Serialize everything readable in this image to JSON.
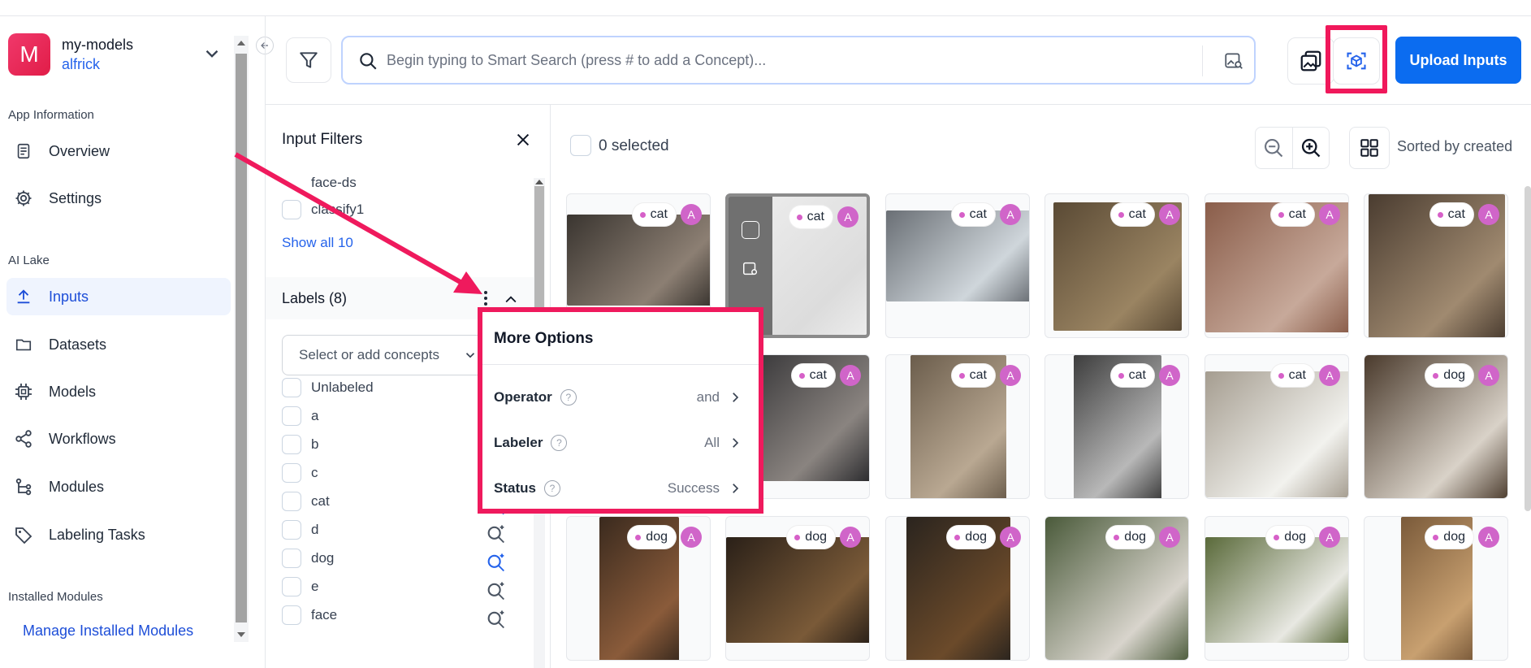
{
  "app": {
    "initial": "M",
    "name": "my-models",
    "user": "alfrick"
  },
  "sidebar": {
    "section_app": "App Information",
    "section_lake": "AI Lake",
    "section_modules": "Installed Modules",
    "items": [
      {
        "label": "Overview",
        "icon": "document-icon"
      },
      {
        "label": "Settings",
        "icon": "gear-icon"
      },
      {
        "label": "Inputs",
        "icon": "upload-icon"
      },
      {
        "label": "Datasets",
        "icon": "folder-icon"
      },
      {
        "label": "Models",
        "icon": "chip-icon"
      },
      {
        "label": "Workflows",
        "icon": "share-nodes-icon"
      },
      {
        "label": "Modules",
        "icon": "branch-icon"
      },
      {
        "label": "Labeling Tasks",
        "icon": "tag-icon"
      }
    ],
    "manage_link": "Manage Installed Modules"
  },
  "toolbar": {
    "search_placeholder": "Begin typing to Smart Search (press # to add a Concept)...",
    "upload_label": "Upload Inputs"
  },
  "filters": {
    "title": "Input Filters",
    "datasets": [
      "face-ds",
      "classify1"
    ],
    "show_all": "Show all 10",
    "labels_title": "Labels (8)",
    "concept_placeholder": "Select or add concepts",
    "labels": [
      "Unlabeled",
      "a",
      "b",
      "c",
      "cat",
      "d",
      "dog",
      "e",
      "face"
    ]
  },
  "gallery": {
    "selected_text": "0 selected",
    "sort_text": "Sorted by created",
    "badge": "A",
    "tags": [
      "cat",
      "cat",
      "cat",
      "cat",
      "cat",
      "cat",
      "cat",
      "cat",
      "cat",
      "cat",
      "cat",
      "dog",
      "dog",
      "dog",
      "dog",
      "dog",
      "dog",
      "dog"
    ]
  },
  "menu": {
    "title": "More Options",
    "rows": [
      {
        "label": "Operator",
        "value": "and"
      },
      {
        "label": "Labeler",
        "value": "All"
      },
      {
        "label": "Status",
        "value": "Success"
      }
    ]
  },
  "colors": {
    "accent": "#0b6cf0",
    "highlight": "#ef1a5d",
    "badge": "#d065c9",
    "avatar": "#e11d48"
  }
}
